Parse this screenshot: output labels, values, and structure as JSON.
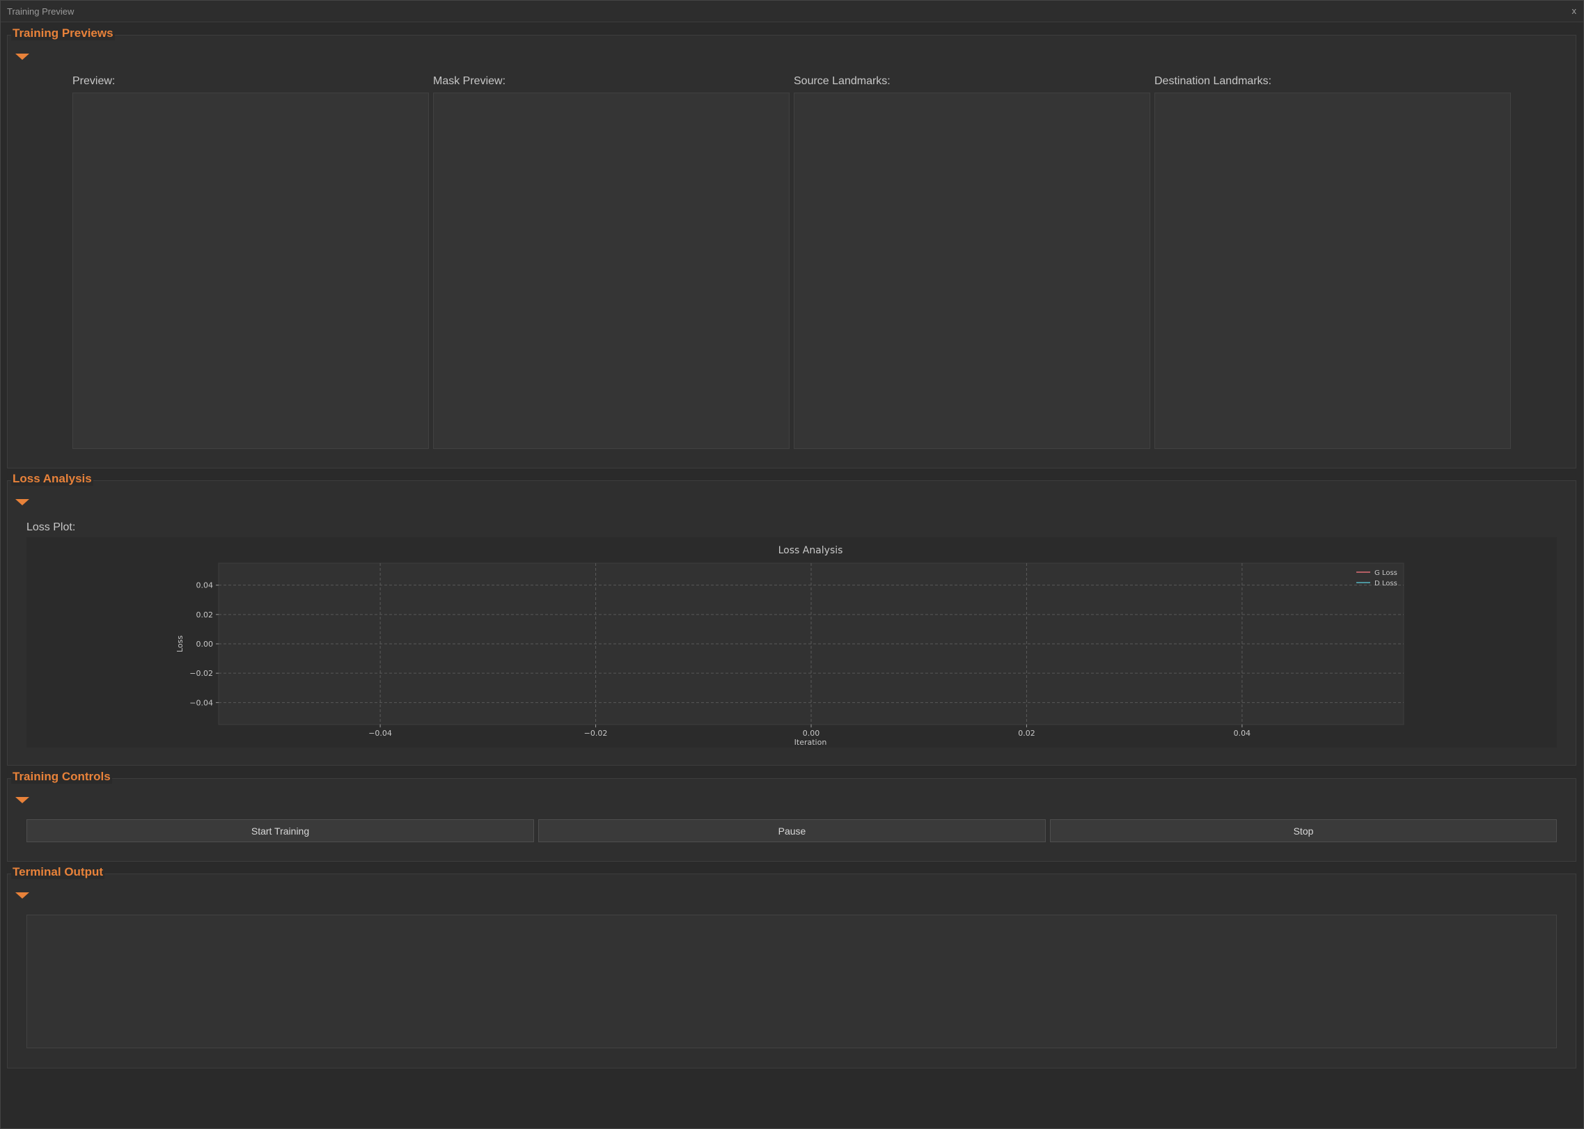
{
  "window": {
    "title": "Training Preview",
    "close_label": "x"
  },
  "sections": {
    "previews": {
      "title": "Training Previews",
      "labels": [
        "Preview:",
        "Mask Preview:",
        "Source Landmarks:",
        "Destination Landmarks:"
      ]
    },
    "loss": {
      "title": "Loss Analysis",
      "plot_label": "Loss Plot:"
    },
    "controls": {
      "title": "Training Controls",
      "start_label": "Start Training",
      "pause_label": "Pause",
      "stop_label": "Stop"
    },
    "terminal": {
      "title": "Terminal Output",
      "content": ""
    }
  },
  "colors": {
    "accent": "#e8823a",
    "g_loss": "#e06c75",
    "d_loss": "#56b6c2"
  },
  "chart_data": {
    "type": "line",
    "title": "Loss Analysis",
    "xlabel": "Iteration",
    "ylabel": "Loss",
    "xlim": [
      -0.055,
      0.055
    ],
    "ylim": [
      -0.055,
      0.055
    ],
    "xticks": [
      -0.04,
      -0.02,
      0.0,
      0.02,
      0.04
    ],
    "xtick_labels": [
      "−0.04",
      "−0.02",
      "0.00",
      "0.02",
      "0.04"
    ],
    "yticks": [
      0.04,
      0.02,
      0.0,
      -0.02,
      -0.04
    ],
    "ytick_labels": [
      "0.04",
      "0.02",
      "0.00",
      "−0.02",
      "−0.04"
    ],
    "grid": true,
    "legend": "top-right",
    "series": [
      {
        "name": "G Loss",
        "color": "#e06c75",
        "x": [],
        "y": []
      },
      {
        "name": "D Loss",
        "color": "#56b6c2",
        "x": [],
        "y": []
      }
    ]
  }
}
